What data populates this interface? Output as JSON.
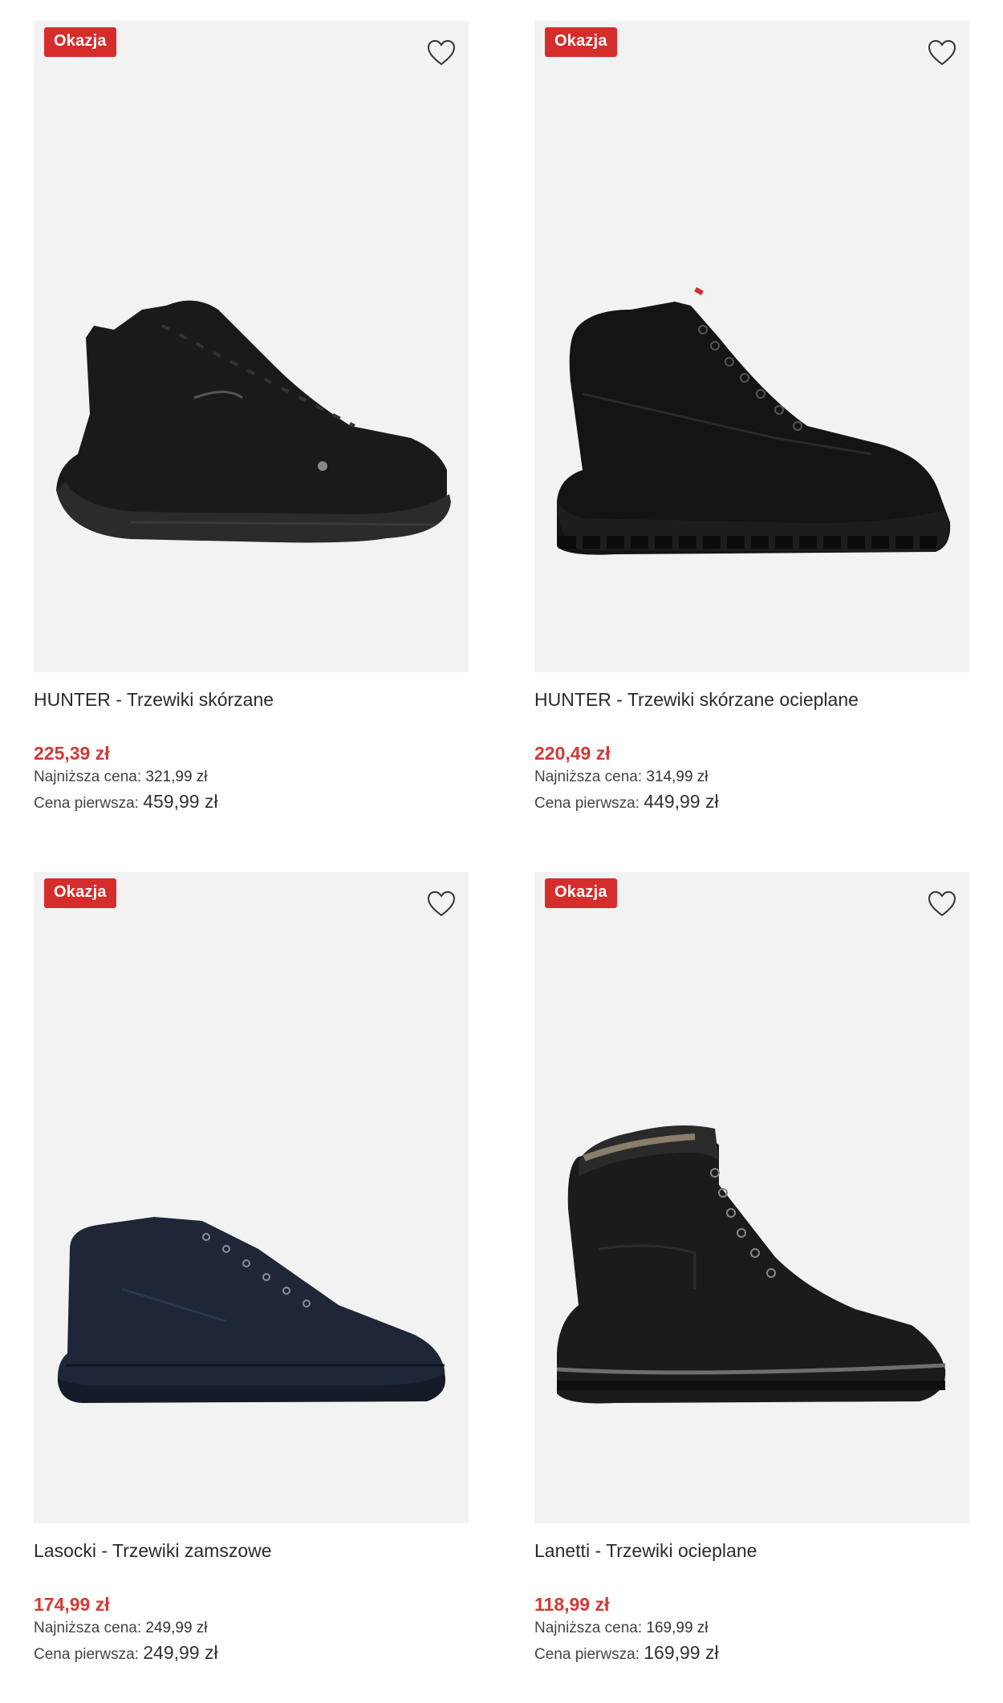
{
  "products": [
    {
      "badge": "Okazja",
      "name": "HUNTER - Trzewiki skórzane",
      "price": "225,39 zł",
      "lowest_label": "Najniższa cena:",
      "lowest_value": "321,99 zł",
      "first_label": "Cena pierwsza:",
      "first_value": "459,99 zł"
    },
    {
      "badge": "Okazja",
      "name": "HUNTER - Trzewiki skórzane ocieplane",
      "price": "220,49 zł",
      "lowest_label": "Najniższa cena:",
      "lowest_value": "314,99 zł",
      "first_label": "Cena pierwsza:",
      "first_value": "449,99 zł"
    },
    {
      "badge": "Okazja",
      "name": "Lasocki - Trzewiki zamszowe",
      "price": "174,99 zł",
      "lowest_label": "Najniższa cena:",
      "lowest_value": "249,99 zł",
      "first_label": "Cena pierwsza:",
      "first_value": "249,99 zł"
    },
    {
      "badge": "Okazja",
      "name": "Lanetti - Trzewiki ocieplane",
      "price": "118,99 zł",
      "lowest_label": "Najniższa cena:",
      "lowest_value": "169,99 zł",
      "first_label": "Cena pierwsza:",
      "first_value": "169,99 zł"
    }
  ],
  "colors": {
    "badge_bg": "#d42d2b",
    "price": "#d23a35",
    "image_bg": "#f2f2f2"
  },
  "icons": {
    "favorite": "heart-outline-icon"
  }
}
